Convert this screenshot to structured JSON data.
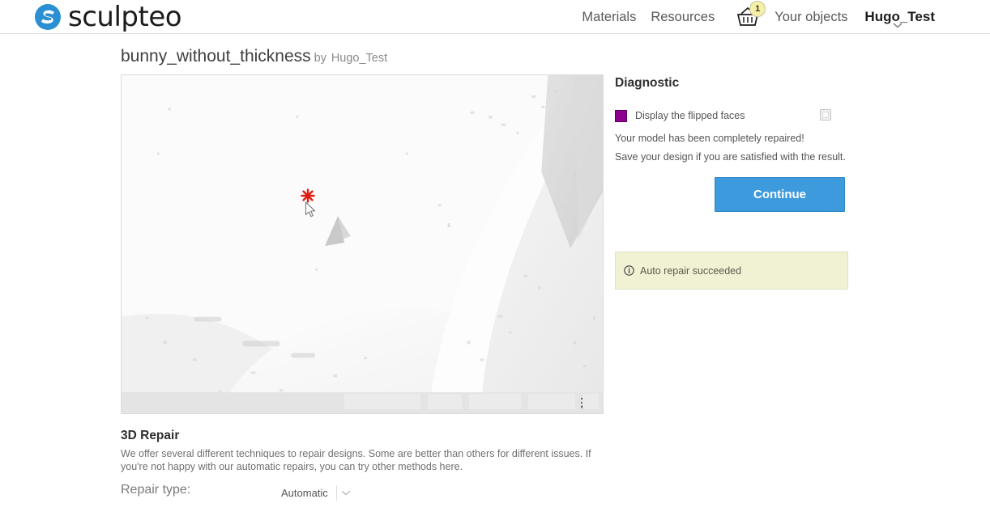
{
  "header": {
    "brand": "sculpteo",
    "brand_icon": "sculpteo-s-logo-icon",
    "nav": [
      {
        "label": "Materials",
        "name": "nav-materials"
      },
      {
        "label": "Resources",
        "name": "nav-resources"
      }
    ],
    "basket": {
      "icon": "shopping-basket-icon",
      "badge_count": "1"
    },
    "your_objects_label": "Your objects",
    "user_label": "Hugo_Test",
    "user_caret_icon": "chevron-down-icon"
  },
  "page": {
    "design_name": "bunny_without_thickness",
    "by_word": "by",
    "owner": "Hugo_Test"
  },
  "viewer": {
    "marker_icon": "red-asterisk-marker-icon",
    "cursor_icon": "mouse-pointer-arrow-icon",
    "settings_icon": "sliders-settings-icon"
  },
  "repair": {
    "title": "3D Repair",
    "description": "We offer several different techniques to repair designs. Some are better than others for different issues. If you're not happy with our automatic repairs, you can try other methods here.",
    "type_label": "Repair type:",
    "type_value": "Automatic",
    "type_caret_icon": "chevron-down-icon",
    "type_options": [
      "Automatic"
    ]
  },
  "diagnostic": {
    "title": "Diagnostic",
    "flipped_faces_label": "Display the flipped faces",
    "flipped_faces_checked": false,
    "swatch_color": "#8e008e",
    "status_line_1": "Your model has been completely repaired!",
    "status_line_2": "Save your design if you are satisfied with the result.",
    "continue_label": "Continue",
    "continue_color": "#3d9bdd",
    "alert": {
      "icon": "info-circle-icon",
      "text": "Auto repair succeeded",
      "background": "#f1f1d4"
    }
  }
}
